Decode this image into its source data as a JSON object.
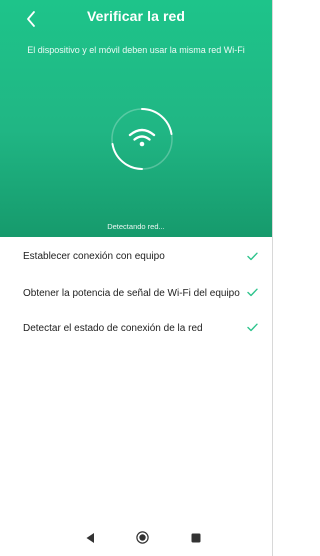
{
  "header": {
    "title": "Verificar la red",
    "subtitle": "El dispositivo y el móvil deben usar la misma red Wi-Fi",
    "status": "Detectando red...",
    "back_icon": "chevron-left-icon",
    "center_icon": "wifi-icon"
  },
  "steps": [
    {
      "label": "Establecer conexión con equipo",
      "status": "done"
    },
    {
      "label": "Obtener la potencia de señal de Wi-Fi del equipo",
      "status": "done"
    },
    {
      "label": "Detectar el estado de conexión de la red",
      "status": "done"
    }
  ],
  "nav": {
    "back_icon": "triangle-back-icon",
    "home_icon": "circle-home-icon",
    "recent_icon": "square-recent-icon"
  },
  "colors": {
    "header_top": "#1ec48a",
    "header_bottom": "#169a6c",
    "check": "#2fc48d",
    "text": "#1e1e1e",
    "nav_icon": "#333333"
  }
}
